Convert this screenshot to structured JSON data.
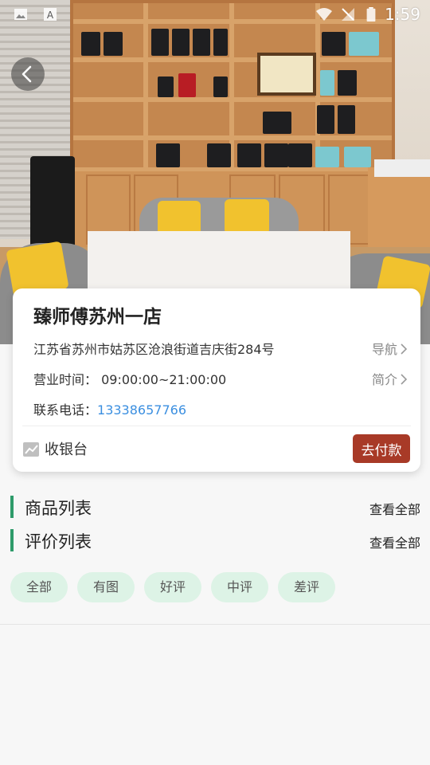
{
  "status_bar": {
    "time": "1:59",
    "icons": [
      "image-icon",
      "text-icon",
      "wifi-icon",
      "no-signal-icon",
      "battery-icon"
    ]
  },
  "header": {
    "back_icon": "chevron-left-icon"
  },
  "store": {
    "name": "臻师傅苏州一店",
    "address": "江苏省苏州市姑苏区沧浪街道吉庆街284号",
    "navigate_label": "导航",
    "hours_label": "营业时间：",
    "hours_value": "09:00:00~21:00:00",
    "intro_label": "简介",
    "phone_label": "联系电话：",
    "phone_value": "13338657766"
  },
  "cashier": {
    "label": "收银台",
    "icon": "chart-icon",
    "pay_button": "去付款"
  },
  "sections": {
    "products": {
      "title": "商品列表",
      "view_all": "查看全部"
    },
    "reviews": {
      "title": "评价列表",
      "view_all": "查看全部"
    }
  },
  "review_filters": [
    "全部",
    "有图",
    "好评",
    "中评",
    "差评"
  ],
  "colors": {
    "accent_green": "#2e9b6a",
    "tag_bg": "#ddf3e6",
    "pay_button": "#a83a27",
    "phone_link": "#3b8fe0"
  }
}
